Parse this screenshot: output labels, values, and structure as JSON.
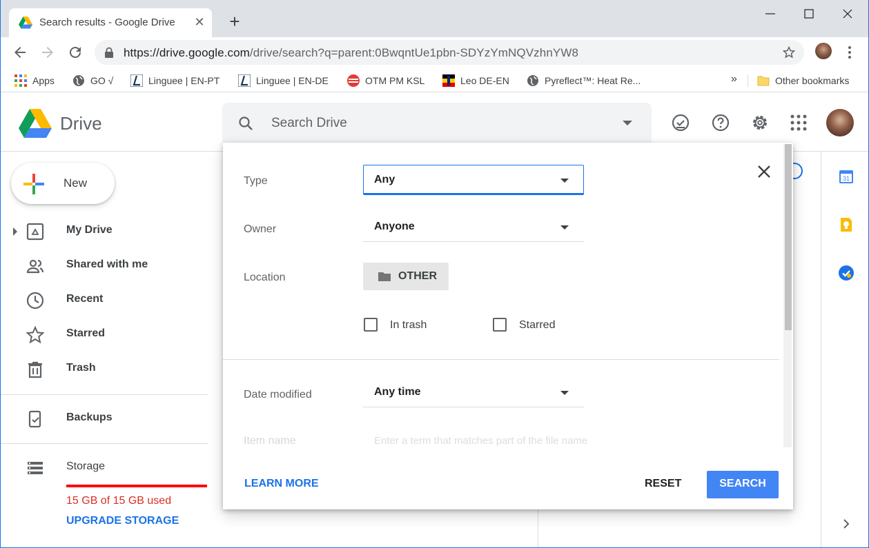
{
  "browser": {
    "tab_title": "Search results - Google Drive",
    "new_tab": "+",
    "url_host": "https://drive.google.com",
    "url_rest": "/drive/search?q=parent:0BwqntUe1pbn-SDYzYmNQVzhnYW8"
  },
  "bookmarks": {
    "items": [
      {
        "label": "Apps",
        "icon": "apps-grid-icon"
      },
      {
        "label": "GO √",
        "icon": "globe-icon"
      },
      {
        "label": "Linguee | EN-PT",
        "icon": "linguee-icon"
      },
      {
        "label": "Linguee | EN-DE",
        "icon": "linguee-icon"
      },
      {
        "label": "OTM PM KSL",
        "icon": "otm-icon"
      },
      {
        "label": "Leo DE-EN",
        "icon": "leo-icon"
      },
      {
        "label": "Pyreflect™: Heat Re...",
        "icon": "globe-icon"
      }
    ],
    "overflow": "»",
    "other": "Other bookmarks"
  },
  "drive": {
    "app_name": "Drive",
    "search_placeholder": "Search Drive"
  },
  "sidebar": {
    "new_label": "New",
    "items": [
      {
        "label": "My Drive",
        "icon": "my-drive-icon"
      },
      {
        "label": "Shared with me",
        "icon": "shared-icon"
      },
      {
        "label": "Recent",
        "icon": "clock-icon"
      },
      {
        "label": "Starred",
        "icon": "star-icon"
      },
      {
        "label": "Trash",
        "icon": "trash-icon"
      },
      {
        "label": "Backups",
        "icon": "backup-icon"
      },
      {
        "label": "Storage",
        "icon": "storage-icon"
      }
    ],
    "storage_used": "15 GB of 15 GB used",
    "storage_fraction": 1.0,
    "upgrade": "UPGRADE STORAGE"
  },
  "dialog": {
    "type_label": "Type",
    "type_value": "Any",
    "owner_label": "Owner",
    "owner_value": "Anyone",
    "location_label": "Location",
    "location_chip": "OTHER",
    "in_trash": "In trash",
    "starred": "Starred",
    "date_label": "Date modified",
    "date_value": "Any time",
    "items_label": "Item name",
    "items_placeholder": "Enter a term that matches part of the file name",
    "learn_more": "LEARN MORE",
    "reset": "RESET",
    "search": "SEARCH"
  },
  "colors": {
    "accent": "#1a73e8",
    "search_button": "#4285f4",
    "storage_full": "#ff0000"
  }
}
